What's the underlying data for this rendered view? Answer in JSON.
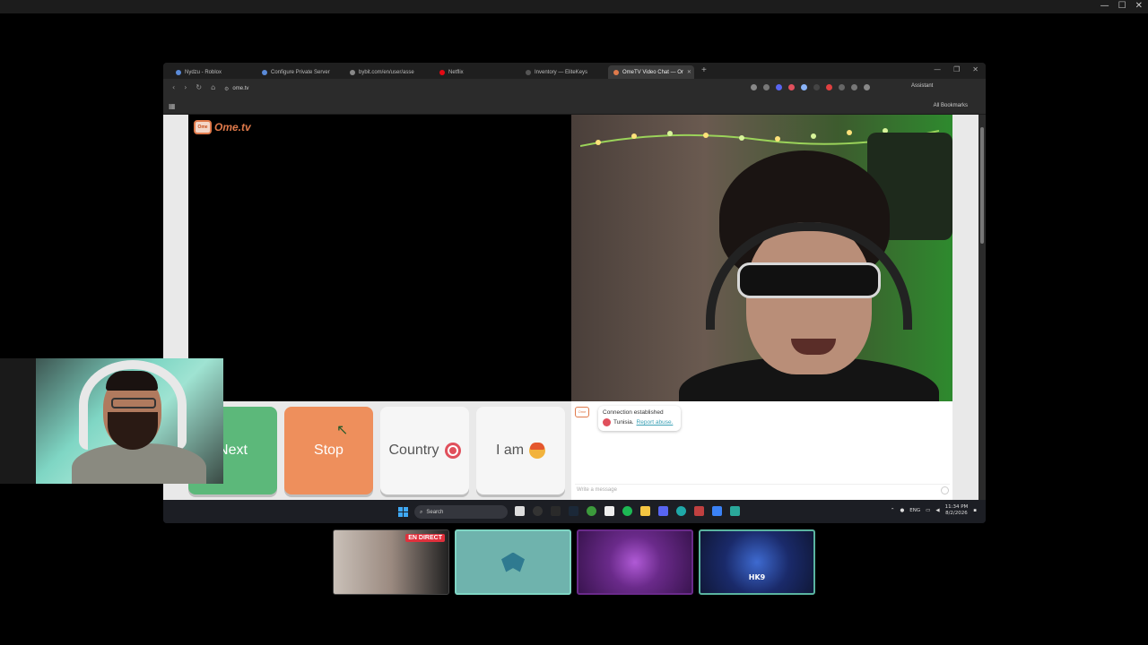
{
  "tabs": [
    {
      "label": "Nydzu - Roblox",
      "color": "#5a8ad8"
    },
    {
      "label": "Configure Private Server",
      "color": "#5a8ad8"
    },
    {
      "label": "bybit.com/en/user/asse",
      "color": "#888888"
    },
    {
      "label": "Netflix",
      "color": "#e50914"
    },
    {
      "label": "Inventory — EliteKeys",
      "color": "#333333"
    },
    {
      "label": "OmeTV Video Chat — Or",
      "color": "#e07a4b"
    }
  ],
  "new_tab_glyph": "+",
  "browser": {
    "url": "ome.tv",
    "assistant_label": "Assistant",
    "all_bookmarks": "All Bookmarks"
  },
  "page": {
    "logo_text": "Ome.tv",
    "logo_badge": "Ome",
    "buttons": {
      "next": "Next",
      "stop": "Stop",
      "country": "Country",
      "iam": "I am"
    },
    "chat": {
      "status": "Connection established",
      "country": "Tunisia.",
      "report": "Report abuse.",
      "placeholder": "Write a message"
    }
  },
  "taskbar": {
    "search_placeholder": "Search",
    "language": "ENG",
    "time": "11:34 PM",
    "date": "8/2/2026"
  },
  "thumbnails": {
    "live_badge": "EN DIRECT",
    "fourth_label": "HK9"
  },
  "colors": {
    "next_green": "#5cb87a",
    "stop_orange": "#ee8f5c",
    "ometv_brand": "#e07a4b"
  }
}
